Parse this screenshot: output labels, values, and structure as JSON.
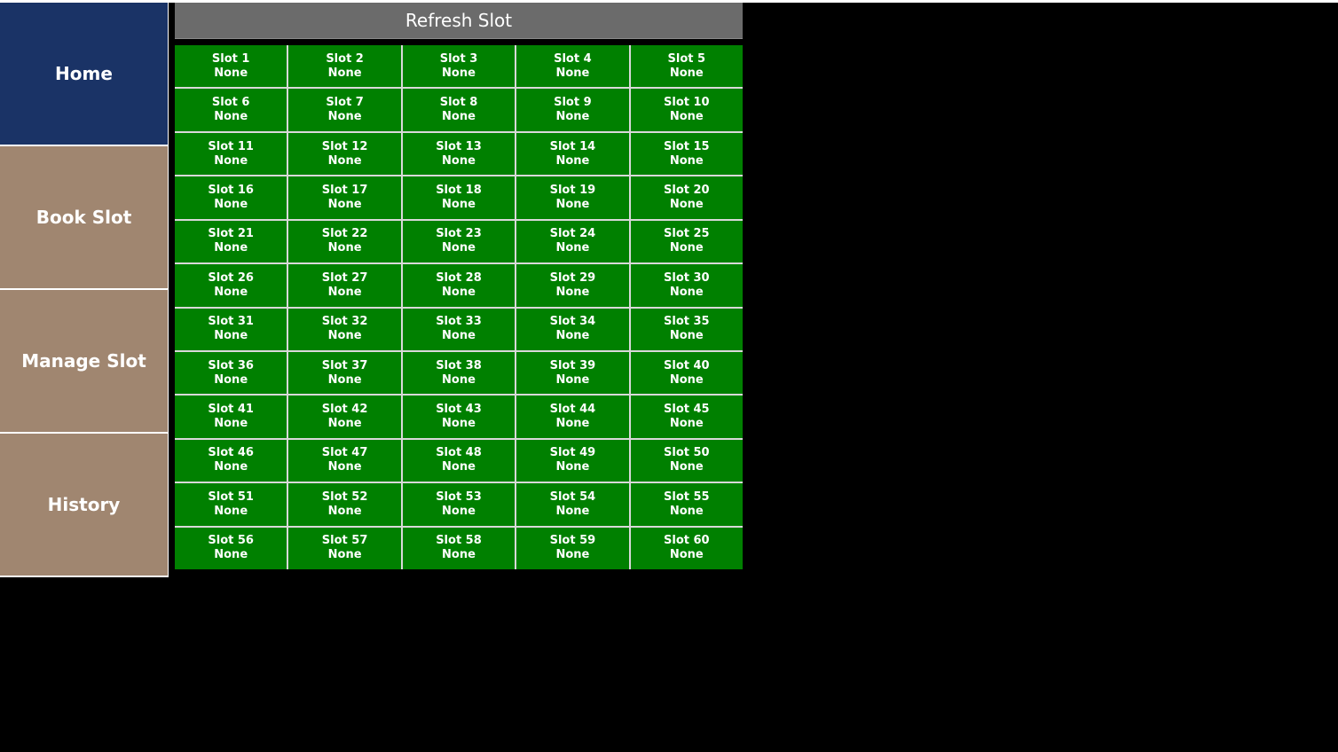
{
  "colors": {
    "home_bg": "#1a3366",
    "nav_bg": "#a08670",
    "refresh_bg": "#6b6b6b",
    "slot_bg": "#008000",
    "page_bg": "#000000"
  },
  "sidebar": {
    "items": [
      {
        "label": "Home",
        "active": true
      },
      {
        "label": "Book Slot",
        "active": false
      },
      {
        "label": "Manage Slot",
        "active": false
      },
      {
        "label": "History",
        "active": false
      }
    ]
  },
  "toolbar": {
    "refresh_label": "Refresh Slot"
  },
  "slots": [
    {
      "name": "Slot 1",
      "status": "None"
    },
    {
      "name": "Slot 2",
      "status": "None"
    },
    {
      "name": "Slot 3",
      "status": "None"
    },
    {
      "name": "Slot 4",
      "status": "None"
    },
    {
      "name": "Slot 5",
      "status": "None"
    },
    {
      "name": "Slot 6",
      "status": "None"
    },
    {
      "name": "Slot 7",
      "status": "None"
    },
    {
      "name": "Slot 8",
      "status": "None"
    },
    {
      "name": "Slot 9",
      "status": "None"
    },
    {
      "name": "Slot 10",
      "status": "None"
    },
    {
      "name": "Slot 11",
      "status": "None"
    },
    {
      "name": "Slot 12",
      "status": "None"
    },
    {
      "name": "Slot 13",
      "status": "None"
    },
    {
      "name": "Slot 14",
      "status": "None"
    },
    {
      "name": "Slot 15",
      "status": "None"
    },
    {
      "name": "Slot 16",
      "status": "None"
    },
    {
      "name": "Slot 17",
      "status": "None"
    },
    {
      "name": "Slot 18",
      "status": "None"
    },
    {
      "name": "Slot 19",
      "status": "None"
    },
    {
      "name": "Slot 20",
      "status": "None"
    },
    {
      "name": "Slot 21",
      "status": "None"
    },
    {
      "name": "Slot 22",
      "status": "None"
    },
    {
      "name": "Slot 23",
      "status": "None"
    },
    {
      "name": "Slot 24",
      "status": "None"
    },
    {
      "name": "Slot 25",
      "status": "None"
    },
    {
      "name": "Slot 26",
      "status": "None"
    },
    {
      "name": "Slot 27",
      "status": "None"
    },
    {
      "name": "Slot 28",
      "status": "None"
    },
    {
      "name": "Slot 29",
      "status": "None"
    },
    {
      "name": "Slot 30",
      "status": "None"
    },
    {
      "name": "Slot 31",
      "status": "None"
    },
    {
      "name": "Slot 32",
      "status": "None"
    },
    {
      "name": "Slot 33",
      "status": "None"
    },
    {
      "name": "Slot 34",
      "status": "None"
    },
    {
      "name": "Slot 35",
      "status": "None"
    },
    {
      "name": "Slot 36",
      "status": "None"
    },
    {
      "name": "Slot 37",
      "status": "None"
    },
    {
      "name": "Slot 38",
      "status": "None"
    },
    {
      "name": "Slot 39",
      "status": "None"
    },
    {
      "name": "Slot 40",
      "status": "None"
    },
    {
      "name": "Slot 41",
      "status": "None"
    },
    {
      "name": "Slot 42",
      "status": "None"
    },
    {
      "name": "Slot 43",
      "status": "None"
    },
    {
      "name": "Slot 44",
      "status": "None"
    },
    {
      "name": "Slot 45",
      "status": "None"
    },
    {
      "name": "Slot 46",
      "status": "None"
    },
    {
      "name": "Slot 47",
      "status": "None"
    },
    {
      "name": "Slot 48",
      "status": "None"
    },
    {
      "name": "Slot 49",
      "status": "None"
    },
    {
      "name": "Slot 50",
      "status": "None"
    },
    {
      "name": "Slot 51",
      "status": "None"
    },
    {
      "name": "Slot 52",
      "status": "None"
    },
    {
      "name": "Slot 53",
      "status": "None"
    },
    {
      "name": "Slot 54",
      "status": "None"
    },
    {
      "name": "Slot 55",
      "status": "None"
    },
    {
      "name": "Slot 56",
      "status": "None"
    },
    {
      "name": "Slot 57",
      "status": "None"
    },
    {
      "name": "Slot 58",
      "status": "None"
    },
    {
      "name": "Slot 59",
      "status": "None"
    },
    {
      "name": "Slot 60",
      "status": "None"
    }
  ]
}
